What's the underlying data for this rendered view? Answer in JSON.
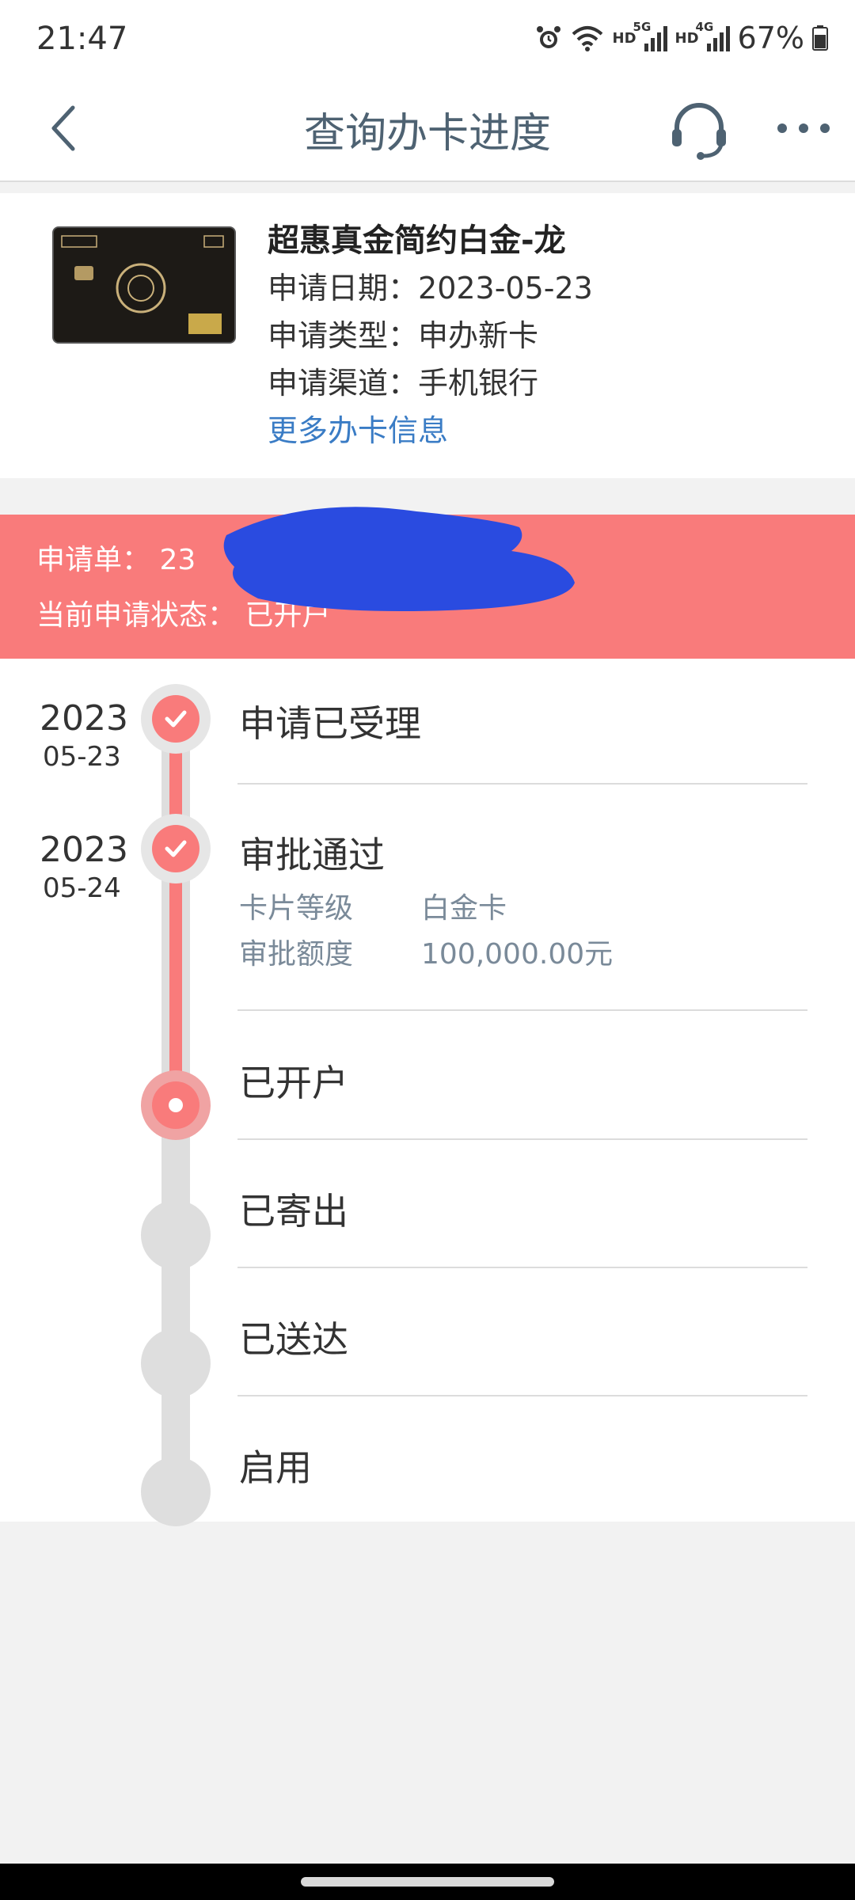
{
  "status_bar": {
    "time": "21:47",
    "hd1": "HD",
    "net1": "5G",
    "hd2": "HD",
    "net2": "4G",
    "battery": "67%"
  },
  "header": {
    "title": "查询办卡进度",
    "icons": [
      "back-icon",
      "headset-icon",
      "more-icon"
    ]
  },
  "card": {
    "name": "超惠真金简约白金-龙",
    "date_label": "申请日期：",
    "date": "2023-05-23",
    "type_label": "申请类型：",
    "type": "申办新卡",
    "channel_label": "申请渠道：",
    "channel": "手机银行",
    "more_link": "更多办卡信息"
  },
  "banner": {
    "order_label": "申请单：",
    "order_value": "23",
    "status_label": "当前申请状态：",
    "status_value": "已开户"
  },
  "timeline": {
    "steps": [
      {
        "title": "申请已受理",
        "year": "2023",
        "md": "05-23"
      },
      {
        "title": "审批通过",
        "year": "2023",
        "md": "05-24"
      },
      {
        "title": "已开户"
      },
      {
        "title": "已寄出"
      },
      {
        "title": "已送达"
      },
      {
        "title": "启用"
      }
    ],
    "details": {
      "level_label": "卡片等级",
      "level_value": "白金卡",
      "limit_label": "审批额度",
      "limit_value": "100,000.00元"
    }
  },
  "colors": {
    "accent": "#f97b7b",
    "link": "#3a7cc5",
    "title": "#4e6272"
  }
}
